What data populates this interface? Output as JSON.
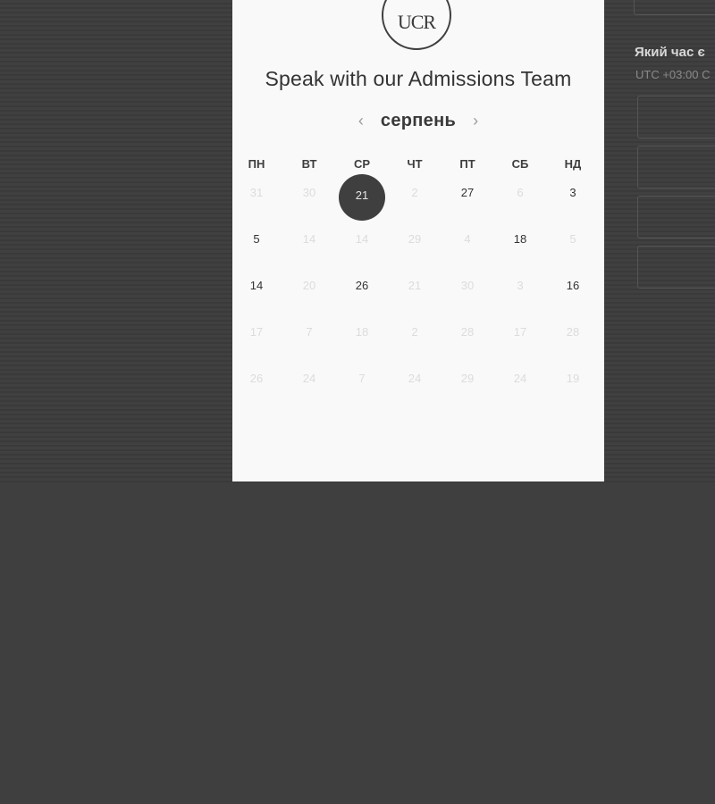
{
  "brand": {
    "logo_text": "UCR"
  },
  "heading": "Speak with our Admissions Team",
  "calendar": {
    "month": "серпень",
    "prev_icon": "‹",
    "next_icon": "›",
    "weekdays": [
      "ПН",
      "ВТ",
      "СР",
      "ЧТ",
      "ПТ",
      "СБ",
      "НД"
    ],
    "weeks": [
      [
        {
          "d": "31",
          "s": "muted"
        },
        {
          "d": "30",
          "s": "muted"
        },
        {
          "d": "21",
          "s": "selected"
        },
        {
          "d": "2",
          "s": "muted"
        },
        {
          "d": "27",
          "s": "active"
        },
        {
          "d": "6",
          "s": "muted"
        },
        {
          "d": "3",
          "s": "active"
        }
      ],
      [
        {
          "d": "5",
          "s": "active"
        },
        {
          "d": "14",
          "s": "muted"
        },
        {
          "d": "14",
          "s": "muted"
        },
        {
          "d": "29",
          "s": "muted"
        },
        {
          "d": "4",
          "s": "muted"
        },
        {
          "d": "18",
          "s": "active"
        },
        {
          "d": "5",
          "s": "muted"
        }
      ],
      [
        {
          "d": "14",
          "s": "active"
        },
        {
          "d": "20",
          "s": "muted"
        },
        {
          "d": "26",
          "s": "active"
        },
        {
          "d": "21",
          "s": "muted"
        },
        {
          "d": "30",
          "s": "muted"
        },
        {
          "d": "3",
          "s": "muted"
        },
        {
          "d": "16",
          "s": "active"
        }
      ],
      [
        {
          "d": "17",
          "s": "muted"
        },
        {
          "d": "7",
          "s": "muted"
        },
        {
          "d": "18",
          "s": "muted"
        },
        {
          "d": "2",
          "s": "muted"
        },
        {
          "d": "28",
          "s": "muted"
        },
        {
          "d": "17",
          "s": "muted"
        },
        {
          "d": "28",
          "s": "muted"
        }
      ],
      [
        {
          "d": "26",
          "s": "muted"
        },
        {
          "d": "24",
          "s": "muted"
        },
        {
          "d": "7",
          "s": "muted"
        },
        {
          "d": "24",
          "s": "muted"
        },
        {
          "d": "29",
          "s": "muted"
        },
        {
          "d": "24",
          "s": "muted"
        },
        {
          "d": "19",
          "s": "muted"
        }
      ]
    ]
  },
  "side_panel": {
    "question": "Який час є",
    "timezone": "UTC +03:00 С"
  }
}
